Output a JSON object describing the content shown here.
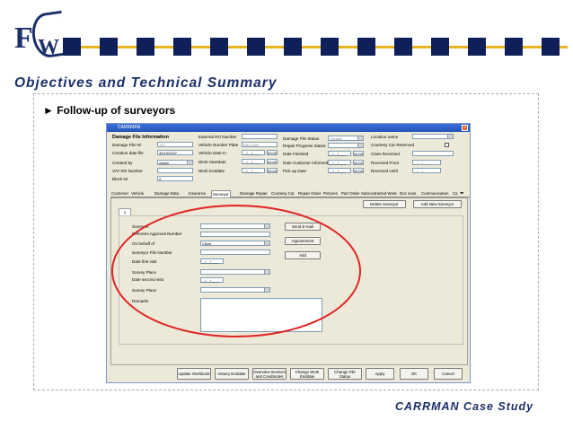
{
  "slide": {
    "title": "Objectives and Technical Summary",
    "bullet": "► Follow-up of surveyors",
    "footer": "CARRMAN Case Study"
  },
  "logo": {
    "letter_f": "F",
    "letter_w": "W"
  },
  "colors": {
    "brand_navy": "#1b2f6b",
    "band_gold": "#e9b51c",
    "highlight_red": "#e02424"
  },
  "window": {
    "title": "CARRMAN",
    "header": {
      "section_title": "Damage File Information",
      "damage_file_nr_label": "Damage File Nr",
      "damage_file_nr_value": "137",
      "creation_date_label": "Creation date file",
      "creation_date_value": "30/10/2007",
      "created_by_label": "Created by",
      "created_by_value": "Admin",
      "vat_ro_label": "VAT RO Number",
      "block_nr_label": "Block Nr",
      "block_nr_value": "0",
      "external_ro_label": "External RO Number",
      "vehicle_plate_label": "Vehicle Number Plate",
      "vehicle_plate_value": "BAC1300",
      "vehicle_date_in_label": "Vehicle Date In",
      "work_startdate_label": "Work Startdate",
      "work_enddate_label": "Work Enddate",
      "date_placeholder": "__/__/____",
      "time_value": "00:00",
      "damage_status_label": "Damage File Status",
      "damage_status_value": "Created",
      "repair_progress_label": "Repair Progress Status",
      "date_finished_label": "Date Finished",
      "date_customer_label": "Date Customer Informed",
      "pickup_date_label": "Pick up Date",
      "location_label": "Location name",
      "courtesy_label": "Courtesy Car Reserved",
      "class_received_label": "Class Received",
      "received_from_label": "Received From",
      "received_until_label": "Received Until"
    },
    "tabs": [
      "Customer",
      "Vehicle",
      "Damage Data",
      "Insurance",
      "Surveyor",
      "Damage Repair",
      "Courtesy Car",
      "Repair Order",
      "Pictures",
      "Part Order",
      "Subcontracted Work",
      "Doc scan",
      "Communication",
      "Ca"
    ],
    "surveyor": {
      "delete_button": "Delete Surveyor",
      "add_button": "Add New Surveyor",
      "subtab": "1",
      "surveyor_label": "Surveyor",
      "approval_label": "Referees Approval Number",
      "on_behalf_label": "On behalf of",
      "on_behalf_value": "Client",
      "file_number_label": "Surveyor File Number",
      "date_first_visit_label": "Date first visit",
      "survey_place_label": "Survey Place",
      "date_second_visit_label": "Date second visit",
      "survey_place2_label": "Survey Place",
      "remarks_label": "Remarks",
      "send_email_button": "Send E-mail",
      "appointment_button": "Appointment",
      "add_small_button": "Add"
    },
    "bottom_buttons": [
      "Update Workbook",
      "History Enddate",
      "Overview Invoices and Creditnotes",
      "Change Work Enddate",
      "Change File Status",
      "Apply",
      "OK",
      "Cancel"
    ]
  }
}
